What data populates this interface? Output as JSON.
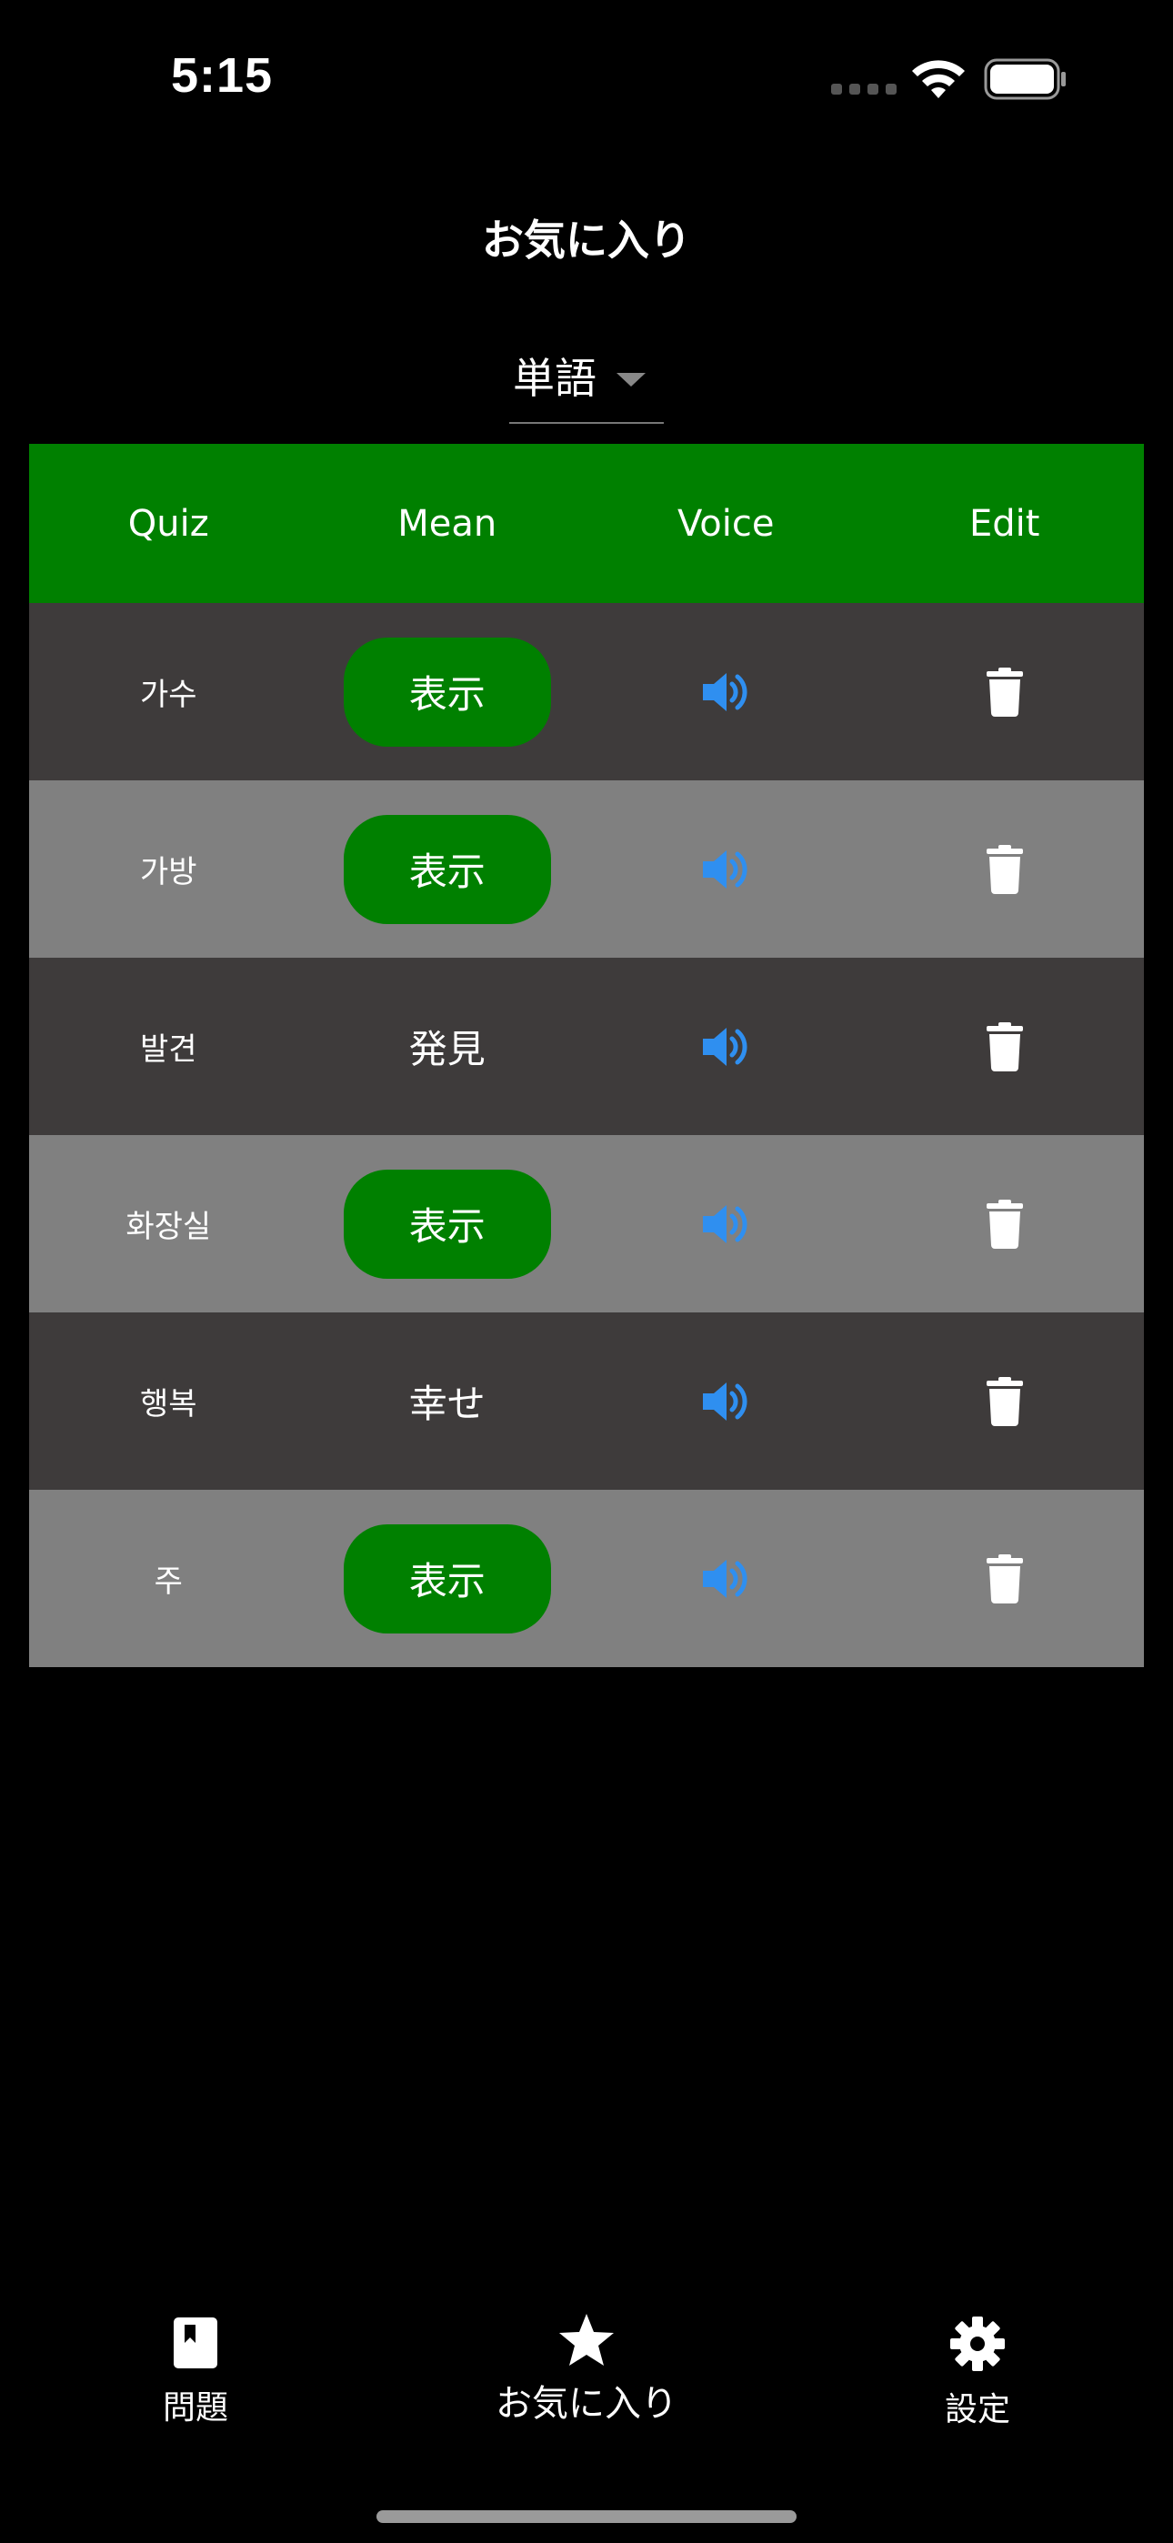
{
  "status_bar": {
    "time": "5:15"
  },
  "header": {
    "title": "お気に入り"
  },
  "dropdown": {
    "selected": "単語"
  },
  "table": {
    "headers": [
      "Quiz",
      "Mean",
      "Voice",
      "Edit"
    ],
    "rows": [
      {
        "quiz": "가수",
        "mean": "表示",
        "mean_is_button": true
      },
      {
        "quiz": "가방",
        "mean": "表示",
        "mean_is_button": true
      },
      {
        "quiz": "발견",
        "mean": "発見",
        "mean_is_button": false
      },
      {
        "quiz": "화장실",
        "mean": "表示",
        "mean_is_button": true
      },
      {
        "quiz": "행복",
        "mean": "幸せ",
        "mean_is_button": false
      },
      {
        "quiz": "주",
        "mean": "表示",
        "mean_is_button": true
      }
    ]
  },
  "tabbar": {
    "items": [
      {
        "label": "問題",
        "icon": "book-icon"
      },
      {
        "label": "お気に入り",
        "icon": "star-icon"
      },
      {
        "label": "設定",
        "icon": "gear-icon"
      }
    ]
  },
  "colors": {
    "accent_green": "#008000",
    "row_dark": "#3e3b3b",
    "row_light": "#808080",
    "speaker_blue": "#2f8ff0"
  }
}
